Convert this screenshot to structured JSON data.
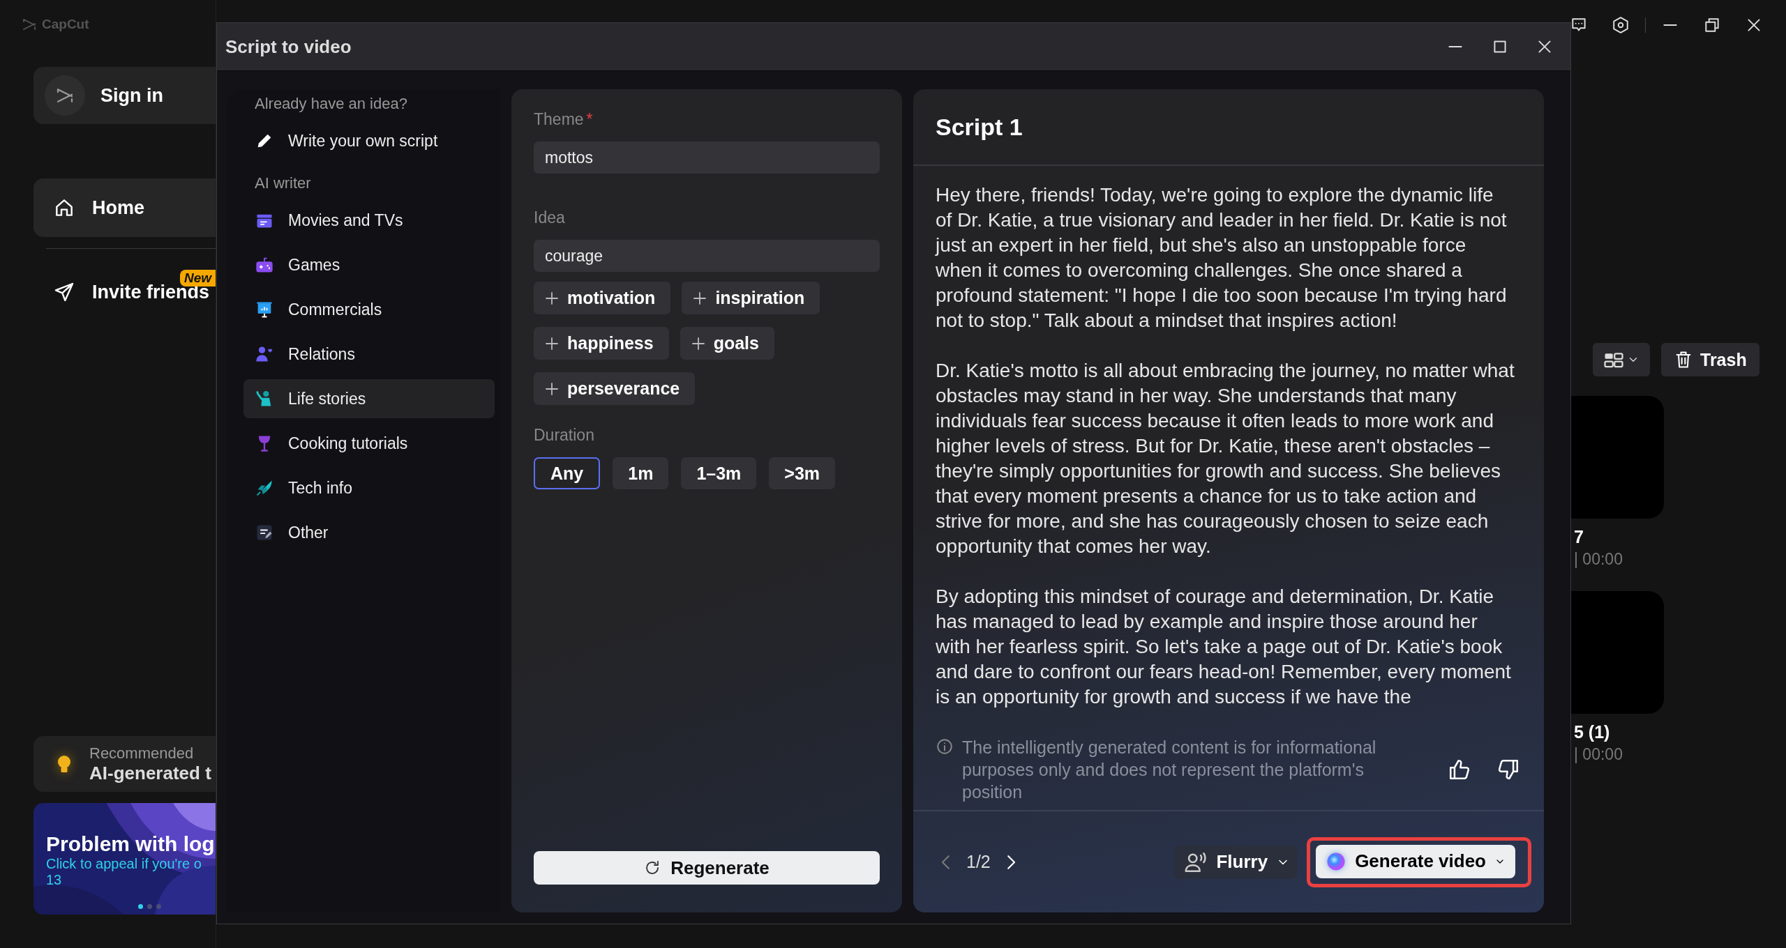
{
  "app": {
    "logo": "CapCut",
    "sign_in": "Sign in",
    "nav": [
      {
        "label": "Home",
        "selected": true
      },
      {
        "label": "Invite friends",
        "selected": false,
        "badge": "New"
      }
    ],
    "recommend": {
      "label": "Recommended",
      "title": "AI-generated t"
    },
    "banner": {
      "title": "Problem with log",
      "text": "Click to appeal if you're o",
      "line2": "13"
    },
    "toolbar": {
      "trash": "Trash"
    },
    "projects": [
      {
        "title": "7",
        "meta": "| 00:00"
      },
      {
        "title": "5 (1)",
        "meta": "| 00:00"
      }
    ]
  },
  "dialog": {
    "title": "Script to video",
    "sidebar": {
      "own_heading": "Already have an idea?",
      "own_item": "Write your own script",
      "ai_heading": "AI writer",
      "items": [
        {
          "label": "Movies and TVs",
          "selected": false
        },
        {
          "label": "Games",
          "selected": false
        },
        {
          "label": "Commercials",
          "selected": false
        },
        {
          "label": "Relations",
          "selected": false
        },
        {
          "label": "Life stories",
          "selected": true
        },
        {
          "label": "Cooking tutorials",
          "selected": false
        },
        {
          "label": "Tech info",
          "selected": false
        },
        {
          "label": "Other",
          "selected": false
        }
      ]
    },
    "form": {
      "theme_label": "Theme",
      "required_mark": "*",
      "theme": "mottos",
      "idea_label": "Idea",
      "idea": "courage",
      "suggestions": [
        "motivation",
        "inspiration",
        "happiness",
        "goals",
        "perseverance"
      ],
      "duration_label": "Duration",
      "durations": [
        {
          "label": "Any",
          "selected": true
        },
        {
          "label": "1m",
          "selected": false
        },
        {
          "label": "1–3m",
          "selected": false
        },
        {
          "label": ">3m",
          "selected": false
        }
      ],
      "regenerate": "Regenerate"
    },
    "script": {
      "title": "Script 1",
      "paragraphs": [
        "Hey there, friends! Today, we're going to explore the dynamic life of Dr. Katie, a true visionary and leader in her field. Dr. Katie is not just an expert in her field, but she's also an unstoppable force when it comes to overcoming challenges. She once shared a profound statement: \"I hope I die too soon because I'm trying hard not to stop.\" Talk about a mindset that inspires action!",
        "Dr. Katie's motto is all about embracing the journey, no matter what obstacles may stand in her way. She understands that many individuals fear success because it often leads to more work and higher levels of stress. But for Dr. Katie, these aren't obstacles – they're simply opportunities for growth and success. She believes that every moment presents a chance for us to take action and strive for more, and she has courageously chosen to seize each opportunity that comes her way.",
        "By adopting this mindset of courage and determination, Dr. Katie has managed to lead by example and inspire those around her with her fearless spirit. So let's take a page out of Dr. Katie's book and dare to confront our fears head-on! Remember, every moment is an opportunity for growth and success if we have the"
      ],
      "disclaimer": "The intelligently generated content is for informational purposes only and does not represent the platform's position",
      "page": "1/2",
      "voice": "Flurry",
      "generate": "Generate video",
      "generate_highlighted": true
    }
  }
}
